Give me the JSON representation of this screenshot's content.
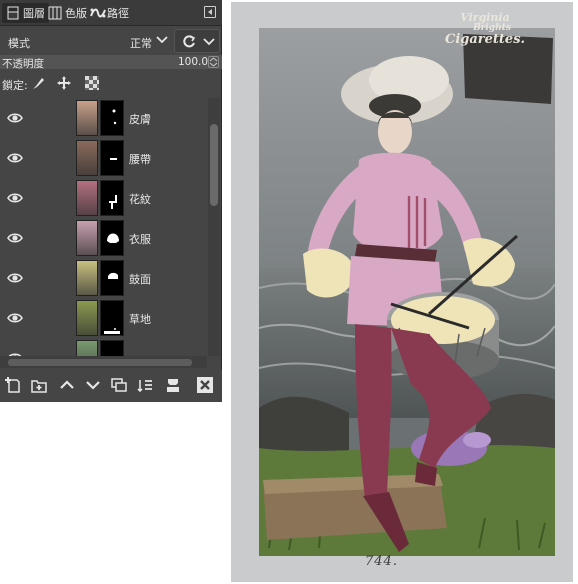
{
  "tabs": [
    {
      "label": "圖層",
      "icon": "layers-icon",
      "active": true
    },
    {
      "label": "色版",
      "icon": "channels-icon",
      "active": false
    },
    {
      "label": "路徑",
      "icon": "paths-icon",
      "active": false
    }
  ],
  "mode": {
    "label": "模式",
    "value": "正常"
  },
  "opacity": {
    "label": "不透明度",
    "value": "100.0"
  },
  "lock": {
    "label": "鎖定:"
  },
  "layers": [
    {
      "name": "皮膚",
      "thumb_color": "#c8a08a",
      "visible": true
    },
    {
      "name": "腰帶",
      "thumb_color": "#8a6a5a",
      "visible": true
    },
    {
      "name": "花紋",
      "thumb_color": "#b47080",
      "visible": true
    },
    {
      "name": "衣服",
      "thumb_color": "#c8a0b0",
      "visible": true
    },
    {
      "name": "鼓面",
      "thumb_color": "#c8c080",
      "visible": true
    },
    {
      "name": "草地",
      "thumb_color": "#8a9a50",
      "visible": true
    },
    {
      "name": "",
      "thumb_color": "#7a9a70",
      "visible": true
    }
  ],
  "toolbar": [
    {
      "icon": "new-layer-icon"
    },
    {
      "icon": "new-layer-group-icon"
    },
    {
      "icon": "raise-layer-icon"
    },
    {
      "icon": "lower-layer-icon"
    },
    {
      "icon": "duplicate-layer-icon"
    },
    {
      "icon": "anchor-layer-icon"
    },
    {
      "icon": "merge-layer-icon"
    },
    {
      "icon": "delete-layer-icon"
    }
  ],
  "photo": {
    "ad_line1": "Virginia",
    "ad_line2": "Brights",
    "ad_line3": "Cigarettes.",
    "caption": "744."
  },
  "colors": {
    "panel_bg": "#454545",
    "dress": "#d9a8c4",
    "sleeves": "#efe3b8",
    "stockings": "#8a3a50",
    "grass": "#5e7a3a",
    "flowers": "#9a78b8"
  }
}
